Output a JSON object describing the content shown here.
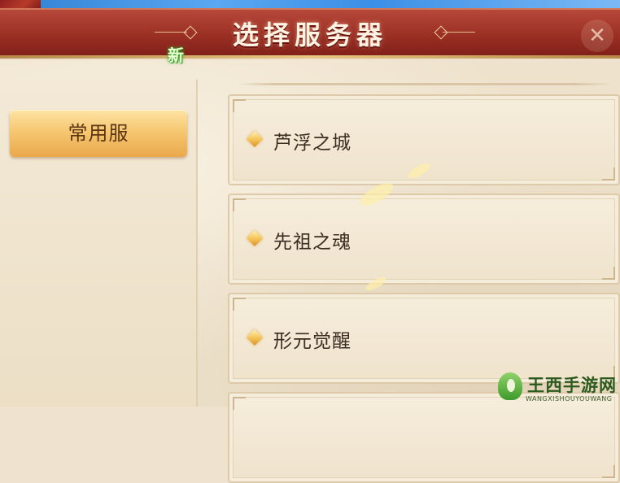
{
  "header": {
    "title": "选择服务器"
  },
  "sidebar": {
    "tabs": [
      {
        "label": "常用服",
        "badge": "新",
        "selected": true
      }
    ]
  },
  "servers": [
    {
      "name": "芦浮之城"
    },
    {
      "name": "先祖之魂"
    },
    {
      "name": "形元觉醒"
    },
    {
      "name": ""
    }
  ],
  "watermark": {
    "name": "王西手游网",
    "url": "WANGXISHOUYOUWANG"
  },
  "colors": {
    "header_red": "#9a2f24",
    "tab_gold": "#f6c772",
    "panel_cream": "#efe3cc",
    "badge_green": "#3fb22a"
  }
}
